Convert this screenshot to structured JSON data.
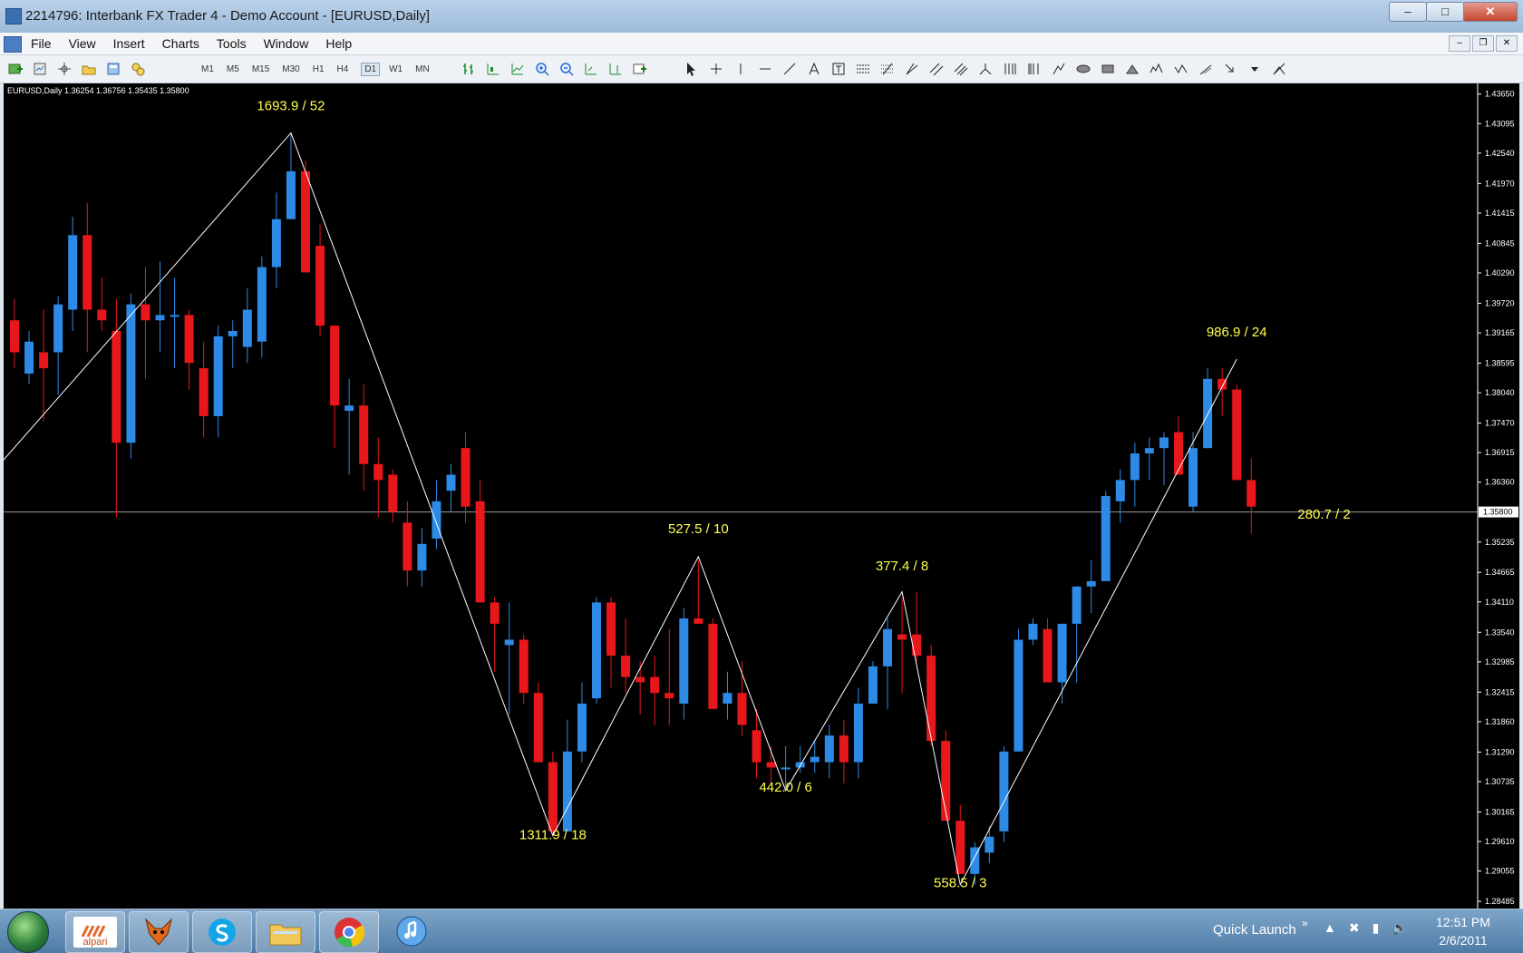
{
  "window": {
    "title": "2214796: Interbank FX Trader 4 - Demo Account - [EURUSD,Daily]",
    "minimize": "–",
    "maximize": "□",
    "close": "✕"
  },
  "menu": {
    "items": [
      "File",
      "View",
      "Insert",
      "Charts",
      "Tools",
      "Window",
      "Help"
    ],
    "mdi_minimize": "–",
    "mdi_restore": "❐",
    "mdi_close": "✕"
  },
  "toolbar": {
    "timeframes": [
      "M1",
      "M5",
      "M15",
      "M30",
      "H1",
      "H4",
      "D1",
      "W1",
      "MN"
    ],
    "active_timeframe": "D1"
  },
  "chart_info": "EURUSD,Daily  1.36254 1.36756 1.35435 1.35800",
  "chart_data": {
    "type": "candlestick",
    "symbol": "EURUSD",
    "period": "Daily",
    "bull_color": "#2d8ae6",
    "bear_color": "#e8171c",
    "zigzag_color": "#ffffff",
    "label_color": "#ffff4d",
    "ylim": [
      1.2835,
      1.4385
    ],
    "y_ticks": [
      "1.43650",
      "1.43095",
      "1.42540",
      "1.41970",
      "1.41415",
      "1.40845",
      "1.40290",
      "1.39720",
      "1.39165",
      "1.38595",
      "1.38040",
      "1.37470",
      "1.36915",
      "1.36360",
      "1.35235",
      "1.34665",
      "1.34110",
      "1.33540",
      "1.32985",
      "1.32415",
      "1.31860",
      "1.31290",
      "1.30735",
      "1.30165",
      "1.29610",
      "1.29055",
      "1.28485"
    ],
    "current_price": "1.35800",
    "candles": [
      [
        1.394,
        1.398,
        1.385,
        1.388
      ],
      [
        1.384,
        1.392,
        1.382,
        1.39
      ],
      [
        1.388,
        1.396,
        1.375,
        1.385
      ],
      [
        1.388,
        1.3985,
        1.38,
        1.397
      ],
      [
        1.396,
        1.4135,
        1.392,
        1.41
      ],
      [
        1.41,
        1.416,
        1.388,
        1.396
      ],
      [
        1.396,
        1.402,
        1.392,
        1.394
      ],
      [
        1.392,
        1.398,
        1.357,
        1.371
      ],
      [
        1.371,
        1.399,
        1.368,
        1.397
      ],
      [
        1.397,
        1.404,
        1.383,
        1.394
      ],
      [
        1.394,
        1.405,
        1.388,
        1.395
      ],
      [
        1.395,
        1.402,
        1.385,
        1.395
      ],
      [
        1.395,
        1.396,
        1.381,
        1.386
      ],
      [
        1.385,
        1.39,
        1.372,
        1.376
      ],
      [
        1.376,
        1.393,
        1.372,
        1.391
      ],
      [
        1.391,
        1.394,
        1.385,
        1.392
      ],
      [
        1.389,
        1.4,
        1.386,
        1.396
      ],
      [
        1.39,
        1.406,
        1.387,
        1.404
      ],
      [
        1.404,
        1.418,
        1.4,
        1.413
      ],
      [
        1.413,
        1.429,
        1.413,
        1.422
      ],
      [
        1.422,
        1.424,
        1.404,
        1.403
      ],
      [
        1.408,
        1.412,
        1.391,
        1.393
      ],
      [
        1.393,
        1.393,
        1.37,
        1.378
      ],
      [
        1.377,
        1.383,
        1.365,
        1.378
      ],
      [
        1.378,
        1.382,
        1.362,
        1.367
      ],
      [
        1.367,
        1.372,
        1.357,
        1.364
      ],
      [
        1.365,
        1.366,
        1.356,
        1.358
      ],
      [
        1.356,
        1.36,
        1.344,
        1.347
      ],
      [
        1.347,
        1.355,
        1.344,
        1.352
      ],
      [
        1.353,
        1.364,
        1.351,
        1.36
      ],
      [
        1.362,
        1.367,
        1.358,
        1.365
      ],
      [
        1.37,
        1.373,
        1.356,
        1.359
      ],
      [
        1.36,
        1.364,
        1.346,
        1.341
      ],
      [
        1.341,
        1.342,
        1.328,
        1.337
      ],
      [
        1.333,
        1.341,
        1.32,
        1.334
      ],
      [
        1.334,
        1.335,
        1.322,
        1.324
      ],
      [
        1.324,
        1.326,
        1.311,
        1.311
      ],
      [
        1.311,
        1.313,
        1.297,
        1.298
      ],
      [
        1.298,
        1.319,
        1.298,
        1.313
      ],
      [
        1.313,
        1.326,
        1.311,
        1.322
      ],
      [
        1.323,
        1.342,
        1.322,
        1.341
      ],
      [
        1.341,
        1.342,
        1.325,
        1.331
      ],
      [
        1.331,
        1.338,
        1.324,
        1.327
      ],
      [
        1.327,
        1.33,
        1.32,
        1.326
      ],
      [
        1.327,
        1.331,
        1.318,
        1.324
      ],
      [
        1.324,
        1.336,
        1.318,
        1.323
      ],
      [
        1.322,
        1.34,
        1.319,
        1.338
      ],
      [
        1.338,
        1.349,
        1.337,
        1.337
      ],
      [
        1.337,
        1.338,
        1.321,
        1.321
      ],
      [
        1.322,
        1.328,
        1.319,
        1.324
      ],
      [
        1.324,
        1.33,
        1.316,
        1.318
      ],
      [
        1.317,
        1.321,
        1.308,
        1.311
      ],
      [
        1.311,
        1.314,
        1.307,
        1.31
      ],
      [
        1.31,
        1.314,
        1.306,
        1.31
      ],
      [
        1.31,
        1.314,
        1.309,
        1.311
      ],
      [
        1.311,
        1.315,
        1.309,
        1.312
      ],
      [
        1.311,
        1.318,
        1.308,
        1.316
      ],
      [
        1.316,
        1.319,
        1.307,
        1.311
      ],
      [
        1.311,
        1.325,
        1.308,
        1.322
      ],
      [
        1.322,
        1.33,
        1.322,
        1.329
      ],
      [
        1.329,
        1.338,
        1.321,
        1.336
      ],
      [
        1.335,
        1.342,
        1.324,
        1.334
      ],
      [
        1.335,
        1.343,
        1.33,
        1.331
      ],
      [
        1.331,
        1.333,
        1.314,
        1.315
      ],
      [
        1.315,
        1.317,
        1.3,
        1.3
      ],
      [
        1.3,
        1.303,
        1.29,
        1.29
      ],
      [
        1.29,
        1.296,
        1.288,
        1.295
      ],
      [
        1.294,
        1.299,
        1.292,
        1.297
      ],
      [
        1.298,
        1.314,
        1.296,
        1.313
      ],
      [
        1.313,
        1.336,
        1.313,
        1.334
      ],
      [
        1.334,
        1.338,
        1.333,
        1.337
      ],
      [
        1.336,
        1.338,
        1.327,
        1.326
      ],
      [
        1.326,
        1.337,
        1.322,
        1.337
      ],
      [
        1.337,
        1.344,
        1.326,
        1.344
      ],
      [
        1.344,
        1.349,
        1.339,
        1.345
      ],
      [
        1.345,
        1.362,
        1.345,
        1.361
      ],
      [
        1.36,
        1.366,
        1.356,
        1.364
      ],
      [
        1.364,
        1.371,
        1.359,
        1.369
      ],
      [
        1.369,
        1.372,
        1.364,
        1.37
      ],
      [
        1.37,
        1.373,
        1.363,
        1.372
      ],
      [
        1.373,
        1.376,
        1.365,
        1.365
      ],
      [
        1.359,
        1.373,
        1.358,
        1.37
      ],
      [
        1.37,
        1.385,
        1.37,
        1.383
      ],
      [
        1.383,
        1.385,
        1.376,
        1.381
      ],
      [
        1.381,
        1.382,
        1.364,
        1.364
      ],
      [
        1.364,
        1.368,
        1.354,
        1.359
      ]
    ],
    "zigzag": [
      {
        "index": -1,
        "price": 1.367
      },
      {
        "index": 19,
        "price": 1.4292
      },
      {
        "index": 37,
        "price": 1.2972
      },
      {
        "index": 47,
        "price": 1.3496
      },
      {
        "index": 53,
        "price": 1.3057
      },
      {
        "index": 61,
        "price": 1.343
      },
      {
        "index": 65,
        "price": 1.288
      },
      {
        "index": 84,
        "price": 1.3867
      }
    ],
    "annotations": [
      {
        "text": "1693.9 / 52",
        "index": 19,
        "price": 1.4335
      },
      {
        "text": "1311.9 / 18",
        "index": 37,
        "price": 1.2965
      },
      {
        "text": "527.5 / 10",
        "index": 47,
        "price": 1.354
      },
      {
        "text": "442.0 / 6",
        "index": 53,
        "price": 1.3055
      },
      {
        "text": "377.4 / 8",
        "index": 61,
        "price": 1.347
      },
      {
        "text": "558.5 / 3",
        "index": 65,
        "price": 1.2875
      },
      {
        "text": "986.9 / 24",
        "index": 84,
        "price": 1.391
      },
      {
        "text": "280.7 / 2",
        "index": 90,
        "price": 1.3567
      }
    ]
  },
  "taskbar": {
    "apps": [
      "alpari",
      "fox",
      "skype",
      "folder",
      "chrome",
      "itunes"
    ],
    "alpari_label": "alpari",
    "quick_launch": "Quick Launch",
    "quick_launch_arrow": "»",
    "time": "12:51 PM",
    "date": "2/6/2011"
  }
}
